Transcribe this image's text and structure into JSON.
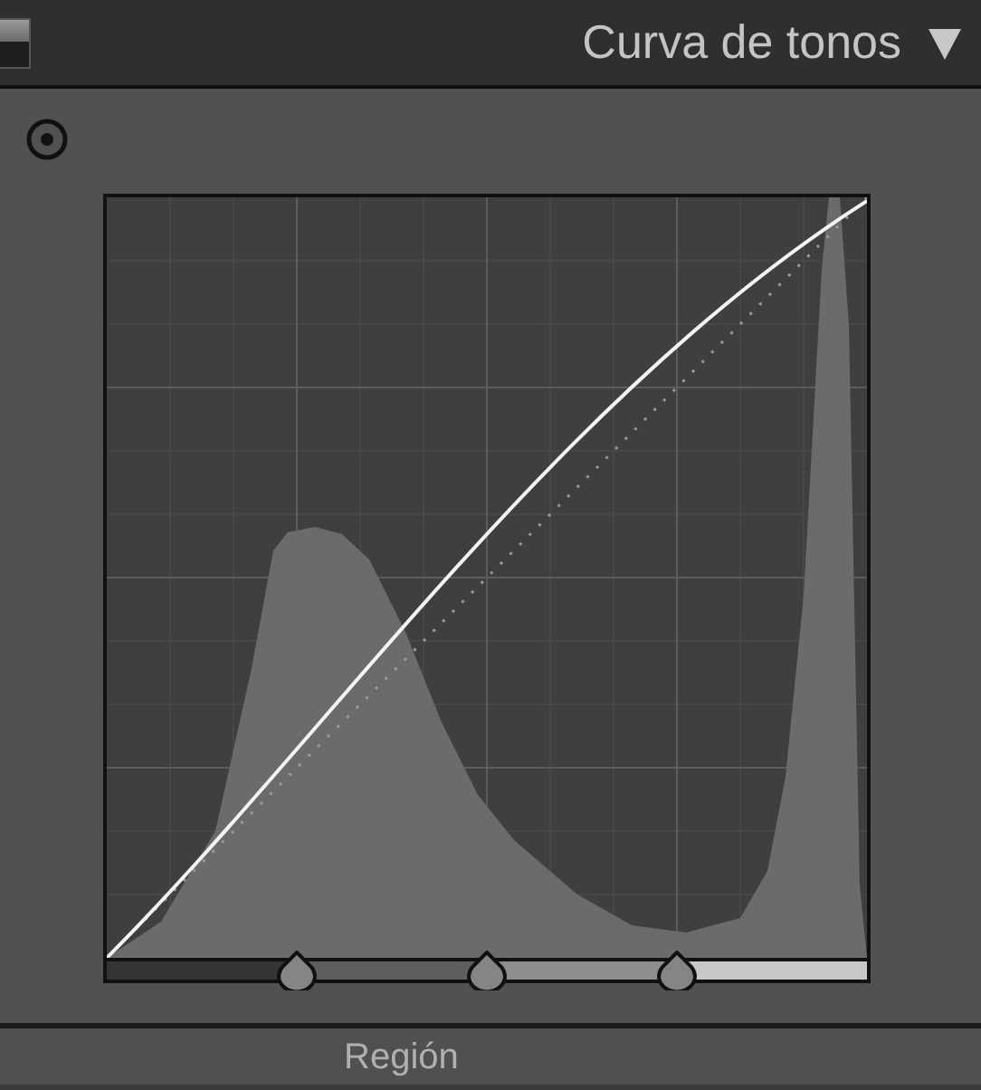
{
  "panel": {
    "title": "Curva de tonos",
    "expanded": true,
    "enabled": true
  },
  "split_points": [
    {
      "level": 0.25
    },
    {
      "level": 0.5
    },
    {
      "level": 0.75
    }
  ],
  "next_section": {
    "label": "Región"
  }
}
